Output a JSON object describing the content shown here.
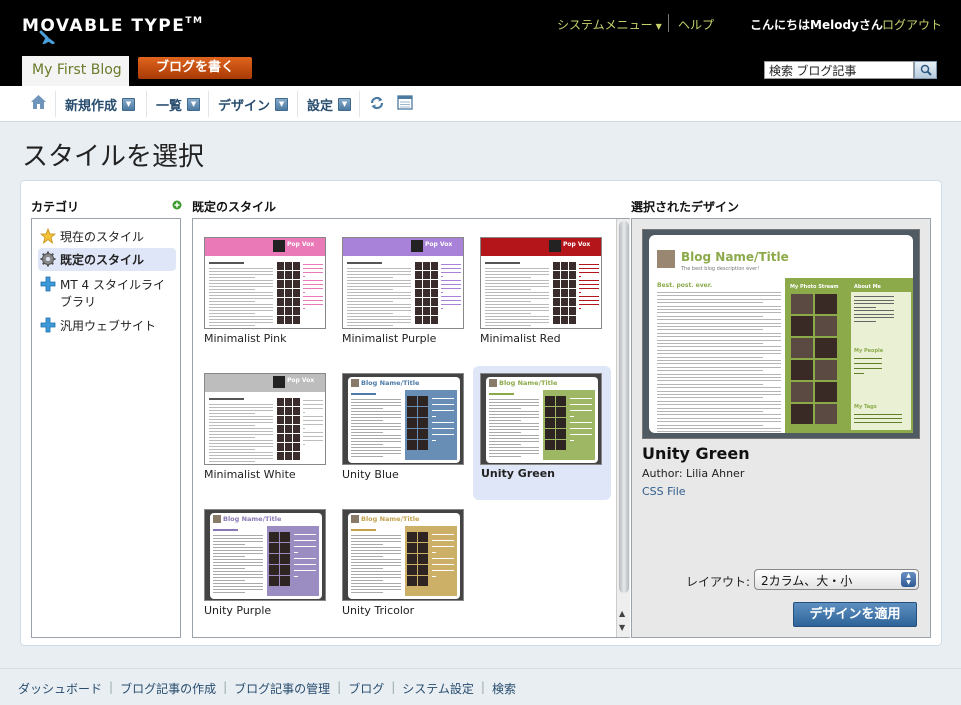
{
  "header": {
    "logo_text": "MOVABLE TYPE",
    "logo_tm": "TM",
    "system_menu": "システムメニュー",
    "help": "ヘルプ",
    "greeting": "こんにちはMelodyさん",
    "logout": "ログアウト",
    "blog_name": "My First Blog",
    "write_button": "ブログを書く",
    "search_value": "検索 ブログ記事"
  },
  "nav": {
    "items": [
      {
        "label": "新規作成"
      },
      {
        "label": "一覧"
      },
      {
        "label": "デザイン"
      },
      {
        "label": "設定"
      }
    ]
  },
  "page": {
    "title": "スタイルを選択"
  },
  "categories": {
    "heading": "カテゴリ",
    "items": [
      {
        "label": "現在のスタイル",
        "icon": "star-icon"
      },
      {
        "label": "既定のスタイル",
        "icon": "gear-icon",
        "selected": true
      },
      {
        "label": "MT 4 スタイルライブラリ",
        "icon": "plus-icon"
      },
      {
        "label": "汎用ウェブサイト",
        "icon": "plus-icon"
      }
    ]
  },
  "styles": {
    "heading": "既定のスタイル",
    "items": [
      {
        "name": "Minimalist Pink",
        "color": "#e97ab7",
        "thumb_title": "Pop Vox"
      },
      {
        "name": "Minimalist Purple",
        "color": "#a782d8",
        "thumb_title": "Pop Vox"
      },
      {
        "name": "Minimalist Red",
        "color": "#b3151a",
        "thumb_title": "Pop Vox"
      },
      {
        "name": "Minimalist White",
        "color": "#bdbdbd",
        "thumb_title": "Pop Vox"
      },
      {
        "name": "Unity Blue",
        "color": "#4d7aa8",
        "thumb_title": "Blog Name/Title"
      },
      {
        "name": "Unity Green",
        "color": "#8caa4a",
        "thumb_title": "Blog Name/Title",
        "selected": true
      },
      {
        "name": "Unity Purple",
        "color": "#8a78b6",
        "thumb_title": "Blog Name/Title"
      },
      {
        "name": "Unity Tricolor",
        "color": "#c3a24e",
        "thumb_title": "Blog Name/Title"
      }
    ]
  },
  "selected_design": {
    "heading": "選択されたデザイン",
    "preview": {
      "blog_title": "Blog Name/Title",
      "tagline": "The best blog description ever!",
      "post_title": "Best. post. ever.",
      "photo_stream": "My Photo Stream",
      "about_me": "About Me",
      "my_people": "My People",
      "my_tags": "My Tags"
    },
    "name": "Unity Green",
    "author": "Author: Lilia Ahner",
    "css_file": "CSS File",
    "layout_label": "レイアウト:",
    "layout_value": "2カラム、大・小",
    "apply_button": "デザインを適用"
  },
  "footer": {
    "links": [
      "ダッシュボード",
      "ブログ記事の作成",
      "ブログ記事の管理",
      "ブログ",
      "システム設定",
      "検索"
    ]
  },
  "colors": {
    "accent_olive": "#c8d26a",
    "write_orange": "#d0561a",
    "nav_text": "#284d6e",
    "selection_bg": "#dfe6f8",
    "apply_blue": "#3a6fa5"
  }
}
